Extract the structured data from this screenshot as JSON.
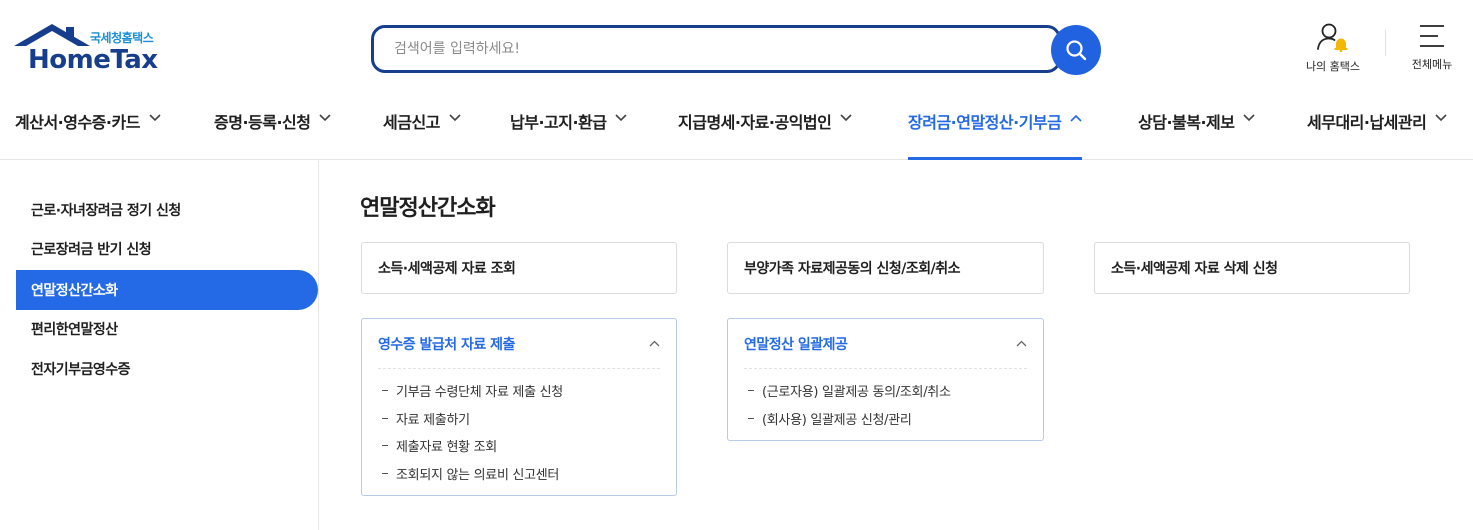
{
  "logo": {
    "small": "국세청홈택스",
    "big": "HomeTax"
  },
  "search": {
    "placeholder": "검색어를 입력하세요!"
  },
  "utility": {
    "my": "나의 홈택스",
    "all": "전체메뉴"
  },
  "gnb": [
    {
      "label": "계산서·영수증·카드",
      "active": false
    },
    {
      "label": "증명·등록·신청",
      "active": false
    },
    {
      "label": "세금신고",
      "active": false
    },
    {
      "label": "납부·고지·환급",
      "active": false
    },
    {
      "label": "지급명세·자료·공익법인",
      "active": false
    },
    {
      "label": "장려금·연말정산·기부금",
      "active": true
    },
    {
      "label": "상담·불복·제보",
      "active": false
    },
    {
      "label": "세무대리·납세관리",
      "active": false
    }
  ],
  "sidebar": [
    {
      "label": "근로·자녀장려금 정기 신청",
      "active": false
    },
    {
      "label": "근로장려금 반기 신청",
      "active": false
    },
    {
      "label": "연말정산간소화",
      "active": true
    },
    {
      "label": "편리한연말정산",
      "active": false
    },
    {
      "label": "전자기부금영수증",
      "active": false
    }
  ],
  "main": {
    "title": "연말정산간소화",
    "cards": [
      "소득·세액공제 자료 조회",
      "부양가족 자료제공동의 신청/조회/취소",
      "소득·세액공제 자료 삭제 신청"
    ],
    "accordions": [
      {
        "title": "영수증 발급처 자료 제출",
        "items": [
          "기부금 수령단체 자료 제출 신청",
          "자료 제출하기",
          "제출자료 현황 조회",
          "조회되지 않는 의료비 신고센터"
        ]
      },
      {
        "title": "연말정산 일괄제공",
        "items": [
          "(근로자용) 일괄제공 동의/조회/취소",
          "(회사용) 일괄제공 신청/관리"
        ]
      }
    ]
  },
  "colors": {
    "accent": "#2469e6",
    "navy": "#163e8c",
    "bell": "#f5b800"
  }
}
